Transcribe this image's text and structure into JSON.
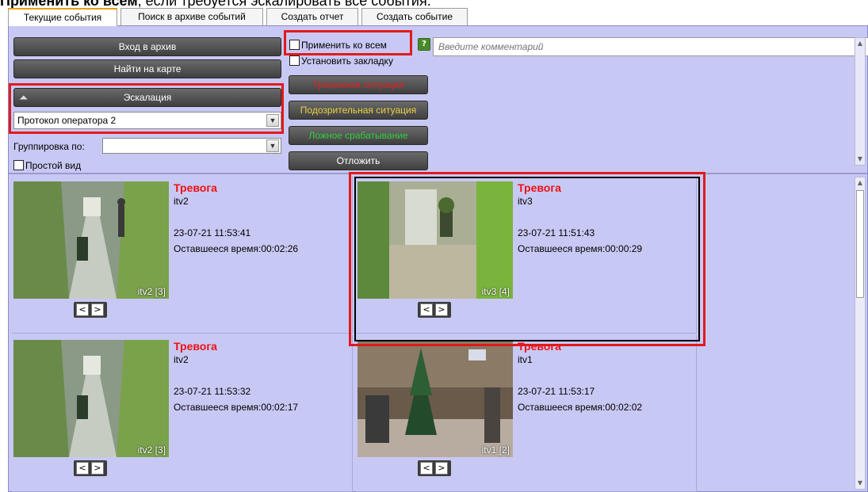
{
  "document": {
    "line_bold": "Применить ко всем",
    "line_rest": ", если требуется эскалировать все события."
  },
  "tabs": [
    {
      "label": "Текущие события",
      "active": true
    },
    {
      "label": "Поиск в архиве событий",
      "active": false
    },
    {
      "label": "Создать отчет",
      "active": false
    },
    {
      "label": "Создать событие",
      "active": false
    }
  ],
  "toolbar": {
    "archive_label": "Вход в архив",
    "map_label": "Найти на карте",
    "escalation_label": "Эскалация",
    "protocol_value": "Протокол оператора 2",
    "group_by_label": "Группировка по:",
    "group_by_value": "",
    "simple_view_label": "Простой вид",
    "apply_all_label": "Применить ко всем",
    "bookmark_label": "Установить закладку",
    "alarm_label": "Тревожная ситуация",
    "suspicious_label": "Подозрительная ситуация",
    "false_label": "Ложное срабатывание",
    "postpone_label": "Отложить",
    "comment_placeholder": "Введите комментарий",
    "help_glyph": "?"
  },
  "colors": {
    "alarm": "#e02020",
    "suspicious": "#e8d040",
    "false": "#2fcf3f",
    "highlight": "#e21a1a",
    "title": "#ee1111",
    "window_bg": "#c8c8f4"
  },
  "events": [
    {
      "title": "Тревога",
      "camera": "itv2",
      "time": "23-07-21 11:53:41",
      "remaining_label": "Оставшееся время:",
      "remaining": "00:02:26",
      "thumb_label": "itv2 [3]"
    },
    {
      "title": "Тревога",
      "camera": "itv3",
      "time": "23-07-21 11:51:43",
      "remaining_label": "Оставшееся время:",
      "remaining": "00:00:29",
      "thumb_label": "itv3 [4]"
    },
    {
      "title": "Тревога",
      "camera": "itv2",
      "time": "23-07-21 11:53:32",
      "remaining_label": "Оставшееся время:",
      "remaining": "00:02:17",
      "thumb_label": "itv2 [3]"
    },
    {
      "title": "Тревога",
      "camera": "itv1",
      "time": "23-07-21 11:53:17",
      "remaining_label": "Оставшееся время:",
      "remaining": "00:02:02",
      "thumb_label": "itv1 [2]"
    }
  ],
  "icons": {
    "prev": "<",
    "next": ">",
    "up_arrow": "▲",
    "down_arrow": "▼",
    "select_arrow": "▼",
    "collapse": "⏶"
  }
}
